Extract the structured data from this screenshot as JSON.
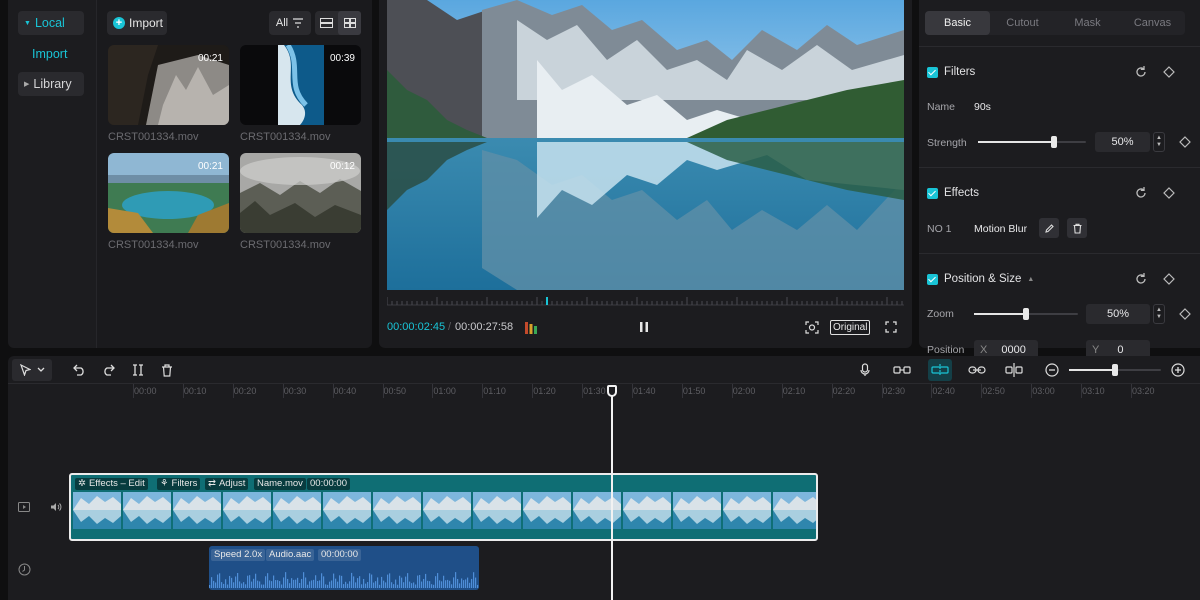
{
  "sidebar": {
    "local_label": "Local",
    "import_label": "Import",
    "library_label": "Library"
  },
  "media": {
    "import_button": "Import",
    "filter_label": "All",
    "items": [
      {
        "duration": "00:21",
        "filename": "CRST001334.mov"
      },
      {
        "duration": "00:39",
        "filename": "CRST001334.mov"
      },
      {
        "duration": "00:21",
        "filename": "CRST001334.mov"
      },
      {
        "duration": "00:12",
        "filename": "CRST001334.mov"
      }
    ]
  },
  "viewer": {
    "current_time": "00:00:02:45",
    "total_time": "00:00:27:58",
    "original_label": "Original"
  },
  "inspector": {
    "tabs": [
      "Basic",
      "Cutout",
      "Mask",
      "Canvas"
    ],
    "active_tab": "Basic",
    "filters": {
      "title": "Filters",
      "name_label": "Name",
      "name_value": "90s",
      "strength_label": "Strength",
      "strength_value": "50%",
      "strength_level": 0.7
    },
    "effects": {
      "title": "Effects",
      "no_label": "NO 1",
      "effect_name": "Motion Blur"
    },
    "position_size": {
      "title": "Position & Size",
      "zoom_label": "Zoom",
      "zoom_value": "50%",
      "zoom_level": 0.5,
      "position_label": "Position",
      "x_label": "X",
      "x_value": "0000",
      "y_label": "Y",
      "y_value": "0"
    }
  },
  "timeline": {
    "ruler_labels": [
      "00:00",
      "00:10",
      "00:20",
      "00:30",
      "00:40",
      "00:50",
      "01:00",
      "01:10",
      "01:20",
      "01:30",
      "01:40",
      "01:50",
      "02:00",
      "02:10",
      "02:20",
      "02:30",
      "02:40",
      "02:50",
      "03:00",
      "03:10",
      "03:20"
    ],
    "zoom_level": 0.5,
    "video_clip": {
      "tags": [
        "Effects – Edit",
        "Filters",
        "Adjust",
        "Name.mov",
        "00:00:00"
      ]
    },
    "audio_clip": {
      "tags": [
        "Speed 2.0x",
        "Audio.aac",
        "00:00:00"
      ]
    }
  },
  "colors": {
    "accent": "#19c4d6",
    "video_clip": "#0f6e74",
    "audio_clip": "#1f4f88",
    "background": "#0f0f10",
    "panel": "#1c1c1f"
  },
  "icons": [
    "plus-circle-icon",
    "filter-icon",
    "list-view-icon",
    "grid-view-icon",
    "pause-icon",
    "screenshot-icon",
    "fullscreen-icon",
    "reset-icon",
    "keyframe-icon",
    "edit-icon",
    "delete-icon",
    "select-arrow-icon",
    "undo-icon",
    "redo-icon",
    "split-icon",
    "trash-icon",
    "microphone-icon",
    "link-icon",
    "magnet-icon",
    "chain-icon",
    "unlink-icon",
    "zoom-out-icon",
    "zoom-in-icon",
    "video-track-icon",
    "volume-icon",
    "audio-track-icon"
  ]
}
